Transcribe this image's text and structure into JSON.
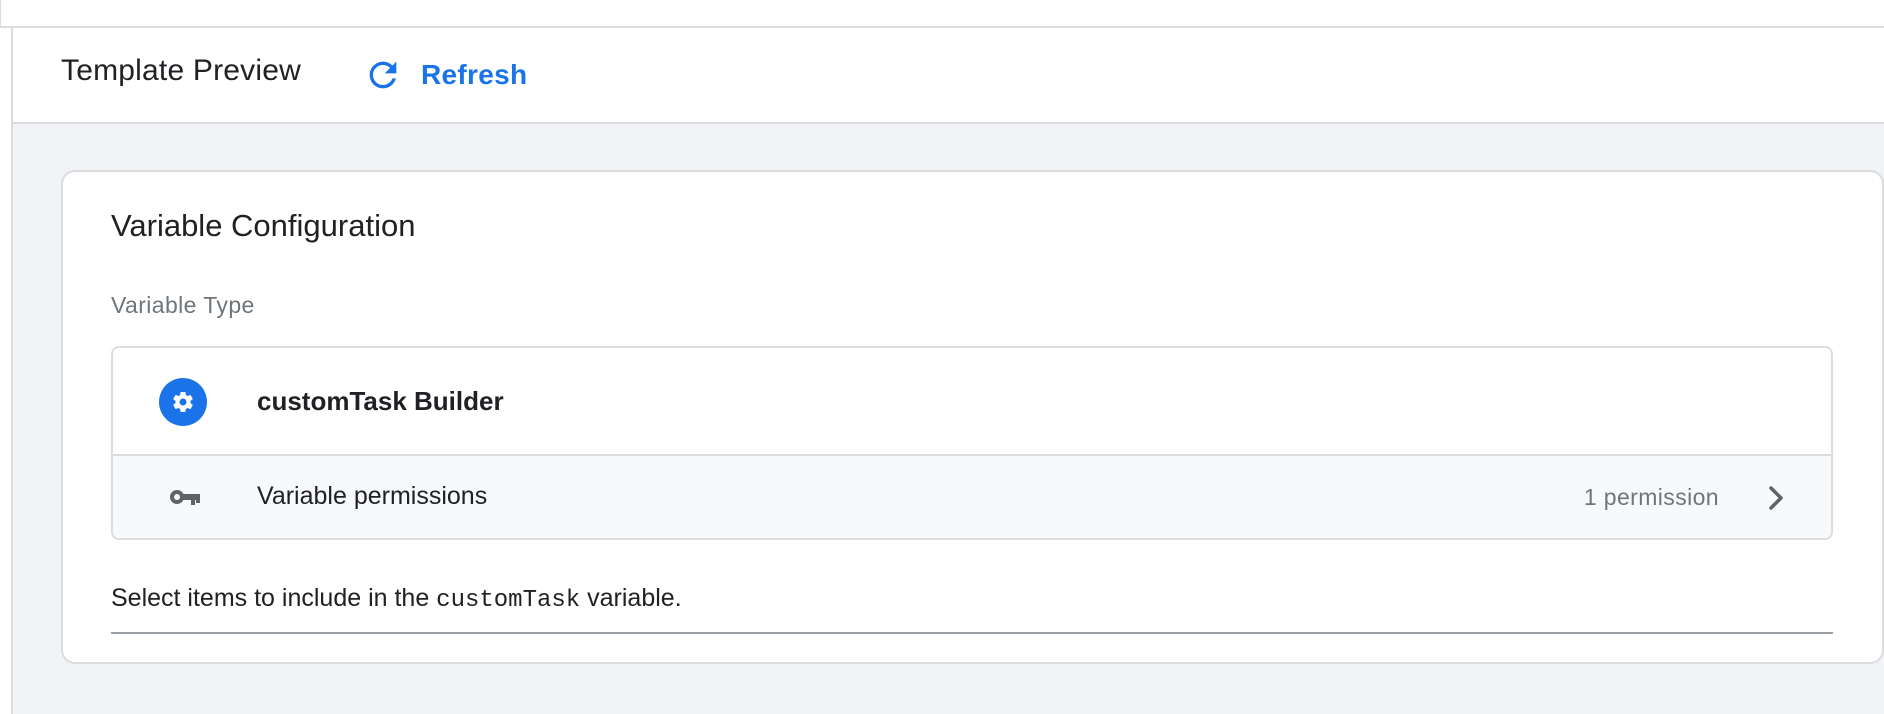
{
  "header": {
    "title": "Template Preview",
    "refresh_label": "Refresh"
  },
  "card": {
    "title": "Variable Configuration",
    "field_label": "Variable Type",
    "variable_type": {
      "icon": "gear-icon",
      "name": "customTask Builder"
    },
    "permissions": {
      "icon": "key-icon",
      "label": "Variable permissions",
      "count_text": "1 permission"
    },
    "help": {
      "prefix": "Select items to include in the ",
      "code": "customTask",
      "suffix": " variable."
    }
  },
  "colors": {
    "accent": "#1a73e8",
    "text_primary": "#202124",
    "text_secondary": "#70757a",
    "border": "#dadce0",
    "panel_bg": "#f1f3f4",
    "row_bg": "#f8f9fa"
  }
}
